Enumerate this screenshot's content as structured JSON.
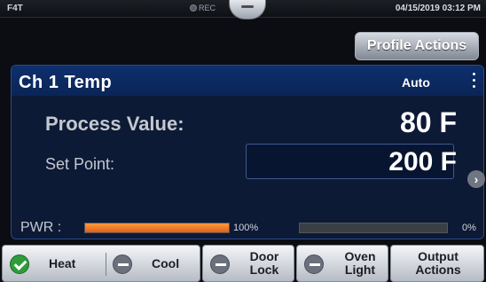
{
  "status_bar": {
    "device": "F4T",
    "rec_label": "REC",
    "datetime": "04/15/2019 03:12 PM"
  },
  "profile_actions_label": "Profile Actions",
  "channel": {
    "title": "Ch 1  Temp",
    "mode": "Auto",
    "process_value_label": "Process Value:",
    "process_value": "80 F",
    "set_point_label": "Set Point:",
    "set_point": "200 F",
    "power_label": "PWR :",
    "heat_power_percent": 100,
    "heat_power_text": "100%",
    "cool_power_percent": 0,
    "cool_power_text": "0%"
  },
  "bottom_bar": {
    "heat_label": "Heat",
    "cool_label": "Cool",
    "door_lock_label": "Door Lock",
    "oven_light_label": "Oven Light",
    "output_actions_label": "Output Actions"
  },
  "colors": {
    "heat_bar": "#e0601a",
    "panel_header": "#0e2f6e",
    "status_on": "#2e9c3a"
  }
}
